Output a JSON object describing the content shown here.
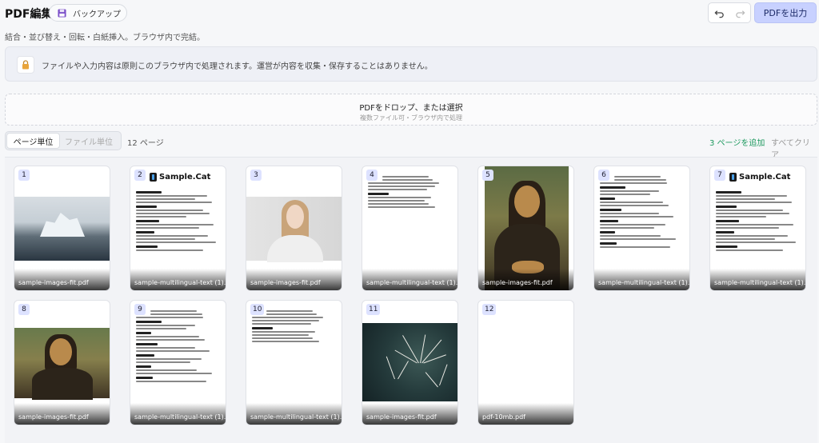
{
  "header": {
    "title": "PDF編集",
    "backup_label": "バックアップ",
    "export_label": "PDFを出力",
    "subtitle": "結合・並び替え・回転・白紙挿入。ブラウザ内で完結。"
  },
  "notice": {
    "text": "ファイルや入力内容は原則このブラウザ内で処理されます。運営が内容を収集・保存することはありません。"
  },
  "dropzone": {
    "title": "PDFをドロップ、または選択",
    "subtitle": "複数ファイル可・ブラウザ内で処理"
  },
  "toolbar": {
    "tab_page": "ページ単位",
    "tab_file": "ファイル単位",
    "page_count": "12 ページ",
    "add_pages": "3 ページを追加",
    "clear_all": "すべてクリア"
  },
  "pages": [
    {
      "num": "1",
      "file": "sample-images-fit.pdf",
      "kind": "iceberg"
    },
    {
      "num": "2",
      "file": "sample-multilingual-text (1).pdf",
      "kind": "samplecat"
    },
    {
      "num": "3",
      "file": "sample-images-fit.pdf",
      "kind": "portrait"
    },
    {
      "num": "4",
      "file": "sample-multilingual-text (1).pdf",
      "kind": "text-short"
    },
    {
      "num": "5",
      "file": "sample-images-fit.pdf",
      "kind": "mona-tall"
    },
    {
      "num": "6",
      "file": "sample-multilingual-text (1).pdf",
      "kind": "text-long"
    },
    {
      "num": "7",
      "file": "sample-multilingual-text (1).pdf",
      "kind": "samplecat"
    },
    {
      "num": "8",
      "file": "sample-images-fit.pdf",
      "kind": "mona-wide"
    },
    {
      "num": "9",
      "file": "sample-multilingual-text (1).pdf",
      "kind": "text-long"
    },
    {
      "num": "10",
      "file": "sample-multilingual-text (1).pdf",
      "kind": "text-short"
    },
    {
      "num": "11",
      "file": "sample-images-fit.pdf",
      "kind": "dandelion"
    },
    {
      "num": "12",
      "file": "pdf-10mb.pdf",
      "kind": "blank"
    }
  ],
  "samplecat_logo": "Sample.Cat",
  "colors": {
    "accent": "#c8d1ff",
    "badge": "#dde2ff",
    "add_link": "#1f9a60"
  }
}
